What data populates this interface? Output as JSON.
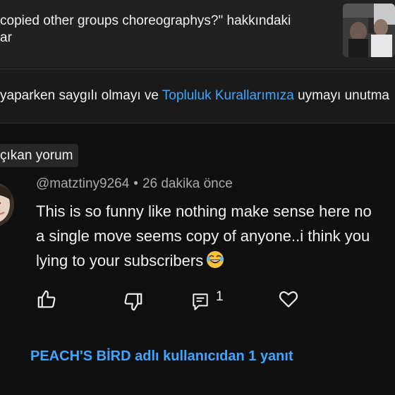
{
  "header": {
    "title": "copied other groups choreographys?\" hakkındaki\nar"
  },
  "notice": {
    "prefix": "yaparken saygılı olmayı ve ",
    "link": "Topluluk Kurallarımıza",
    "suffix": " uymayı unutma"
  },
  "pinned_chip": {
    "label": "çıkan yorum"
  },
  "comment": {
    "author": "@matztiny9264",
    "separator": "•",
    "time": "26 dakika önce",
    "lines": [
      "This is so funny like nothing make sense here no",
      "a single move seems copy of anyone..i think you",
      "lying to your subscribers"
    ],
    "emoji": "tears-of-joy-emoji",
    "reply_count": "1"
  },
  "replies_link": "PEACH'S BİRD adlı kullanıcıdan 1 yanıt",
  "colors": {
    "background": "#0f0f0f",
    "header_bg": "#212121",
    "link": "#3ea6ff",
    "muted": "#aaaaaa"
  }
}
